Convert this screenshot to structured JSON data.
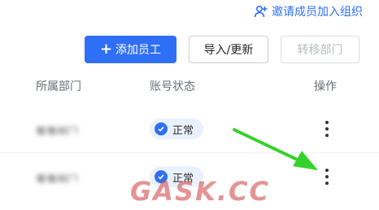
{
  "invite": {
    "label": "邀请成员加入组织",
    "icon": "add-user-icon"
  },
  "toolbar": {
    "add_label": "添加员工",
    "import_label": "导入/更新",
    "transfer_label": "转移部门"
  },
  "columns": {
    "department": "所属部门",
    "account_status": "账号状态",
    "actions": "操作"
  },
  "rows": [
    {
      "department": "董事部门",
      "status": "正常",
      "actions_icon": "more-vertical-icon"
    },
    {
      "department": "董事部门",
      "status": "正常",
      "actions_icon": "more-vertical-icon"
    }
  ],
  "watermark": "GASK.CC",
  "colors": {
    "primary": "#2f6ff5",
    "status_bg": "#eaf1fe",
    "annotation_arrow": "#35d22b",
    "watermark": "#cd3c3c"
  }
}
